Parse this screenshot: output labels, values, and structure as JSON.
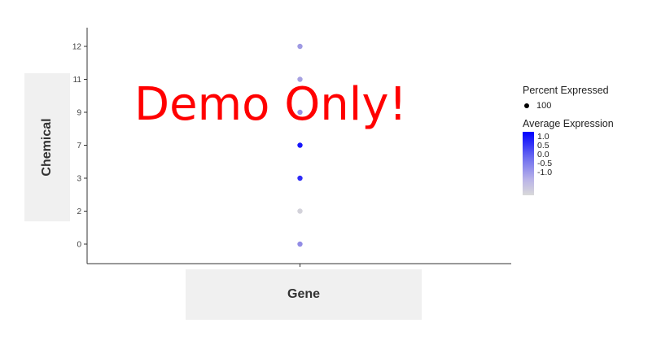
{
  "chart_data": {
    "type": "scatter",
    "subtype": "dot-plot",
    "xlabel": "Gene",
    "ylabel": "Chemical",
    "x_categories": [
      ""
    ],
    "y_categories": [
      "0",
      "2",
      "3",
      "7",
      "9",
      "11",
      "12"
    ],
    "points": [
      {
        "x": "",
        "y": "12",
        "avg_expression": -0.3,
        "pct_expressed": 100
      },
      {
        "x": "",
        "y": "11",
        "avg_expression": -0.4,
        "pct_expressed": 100
      },
      {
        "x": "",
        "y": "9",
        "avg_expression": -0.2,
        "pct_expressed": 100
      },
      {
        "x": "",
        "y": "7",
        "avg_expression": 1.0,
        "pct_expressed": 100
      },
      {
        "x": "",
        "y": "3",
        "avg_expression": 0.8,
        "pct_expressed": 100
      },
      {
        "x": "",
        "y": "2",
        "avg_expression": -1.1,
        "pct_expressed": 100
      },
      {
        "x": "",
        "y": "0",
        "avg_expression": -0.1,
        "pct_expressed": 100
      }
    ],
    "legend": {
      "size_title": "Percent Expressed",
      "size_values": [
        "100"
      ],
      "color_title": "Average Expression",
      "color_ticks": [
        "1.0",
        "0.5",
        "0.0",
        "-0.5",
        "-1.0"
      ],
      "color_range": [
        -1.2,
        1.2
      ],
      "color_low": "#d9d9d9",
      "color_high": "#0000ff",
      "placement": "right"
    },
    "grid": false
  },
  "watermark": "Demo Only!"
}
